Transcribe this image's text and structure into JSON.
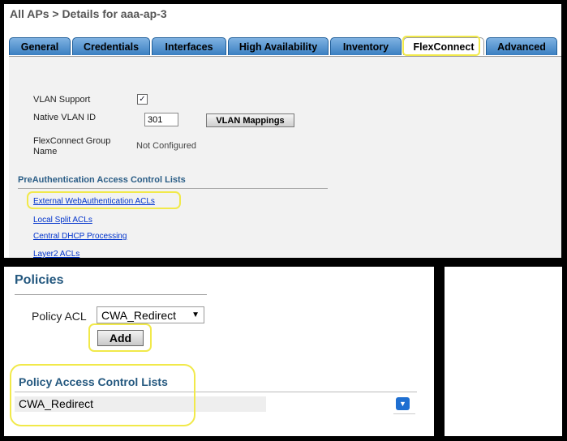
{
  "header": {
    "title": "All APs > Details for aaa-ap-3"
  },
  "tabs": [
    {
      "label": "General"
    },
    {
      "label": "Credentials"
    },
    {
      "label": "Interfaces"
    },
    {
      "label": "High Availability"
    },
    {
      "label": "Inventory"
    },
    {
      "label": "FlexConnect",
      "active": true
    },
    {
      "label": "Advanced"
    }
  ],
  "flexconnect": {
    "vlan_support_label": "VLAN Support",
    "vlan_support_checked": "✓",
    "native_vlan_label": "Native VLAN ID",
    "native_vlan_value": "301",
    "vlan_mappings_button": "VLAN Mappings",
    "group_name_label_1": "FlexConnect Group",
    "group_name_label_2": "Name",
    "group_name_value": "Not Configured",
    "preauth_title": "PreAuthentication Access Control Lists",
    "links": [
      "External WebAuthentication ACLs",
      "Local Split ACLs",
      "Central DHCP Processing",
      "Layer2 ACLs"
    ]
  },
  "policies": {
    "title": "Policies",
    "acl_label": "Policy ACL",
    "acl_selected": "CWA_Redirect",
    "add_button": "Add",
    "list_title": "Policy Access Control Lists",
    "rows": [
      "CWA_Redirect"
    ]
  },
  "colors": {
    "highlight": "#f1e94a",
    "tab_blue": "#3e86c8",
    "section_blue": "#24587f"
  }
}
